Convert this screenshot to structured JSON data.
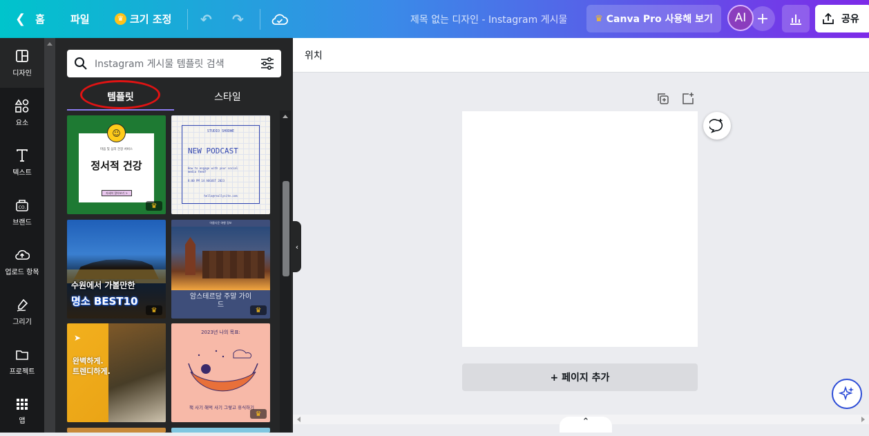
{
  "topbar": {
    "home_label": "홈",
    "file_label": "파일",
    "resize_label": "크기 조정",
    "title": "제목 없는 디자인 - Instagram 게시물",
    "pro_button": "Canva Pro 사용해 보기",
    "avatar_text": "AI",
    "share_label": "공유"
  },
  "sidenav": {
    "items": [
      {
        "label": "디자인",
        "icon": "layout-icon"
      },
      {
        "label": "요소",
        "icon": "shapes-icon"
      },
      {
        "label": "텍스트",
        "icon": "text-icon"
      },
      {
        "label": "브랜드",
        "icon": "brand-icon"
      },
      {
        "label": "업로드 항목",
        "icon": "upload-icon"
      },
      {
        "label": "그리기",
        "icon": "draw-icon"
      },
      {
        "label": "프로젝트",
        "icon": "folder-icon"
      },
      {
        "label": "앱",
        "icon": "apps-icon"
      }
    ]
  },
  "panel": {
    "search_placeholder": "Instagram 게시물 템플릿 검색",
    "tabs": [
      "템플릿",
      "스타일"
    ],
    "templates": [
      {
        "title": "정서적 건강",
        "subtitle": "마음 및 심리 건강 서비스",
        "button": "자세히 알아보기 >"
      },
      {
        "brand": "STUDIO SHODWE",
        "title": "NEW PODCAST",
        "text": "How to engage with your social media feed?",
        "date": "8:00 PM 14 AUGUST 2023",
        "footer": "hello@reallysite.com"
      },
      {
        "line1": "수원에서 가볼만한",
        "line2": "명소 BEST10"
      },
      {
        "header": "아름다운 여행 정보",
        "title": "암스테르담 주말 가이드"
      },
      {
        "line1": "완벽하게.",
        "line2": "트렌디하게."
      },
      {
        "title": "2023년 나의 목표:",
        "caption": "책 사기 해먹 사기 그렇고 휴식하기"
      }
    ]
  },
  "canvas": {
    "position_label": "위치",
    "add_page_label": "+ 페이지 추가"
  },
  "colors": {
    "accent": "#7d2ae8",
    "annotation": "#e01313"
  }
}
